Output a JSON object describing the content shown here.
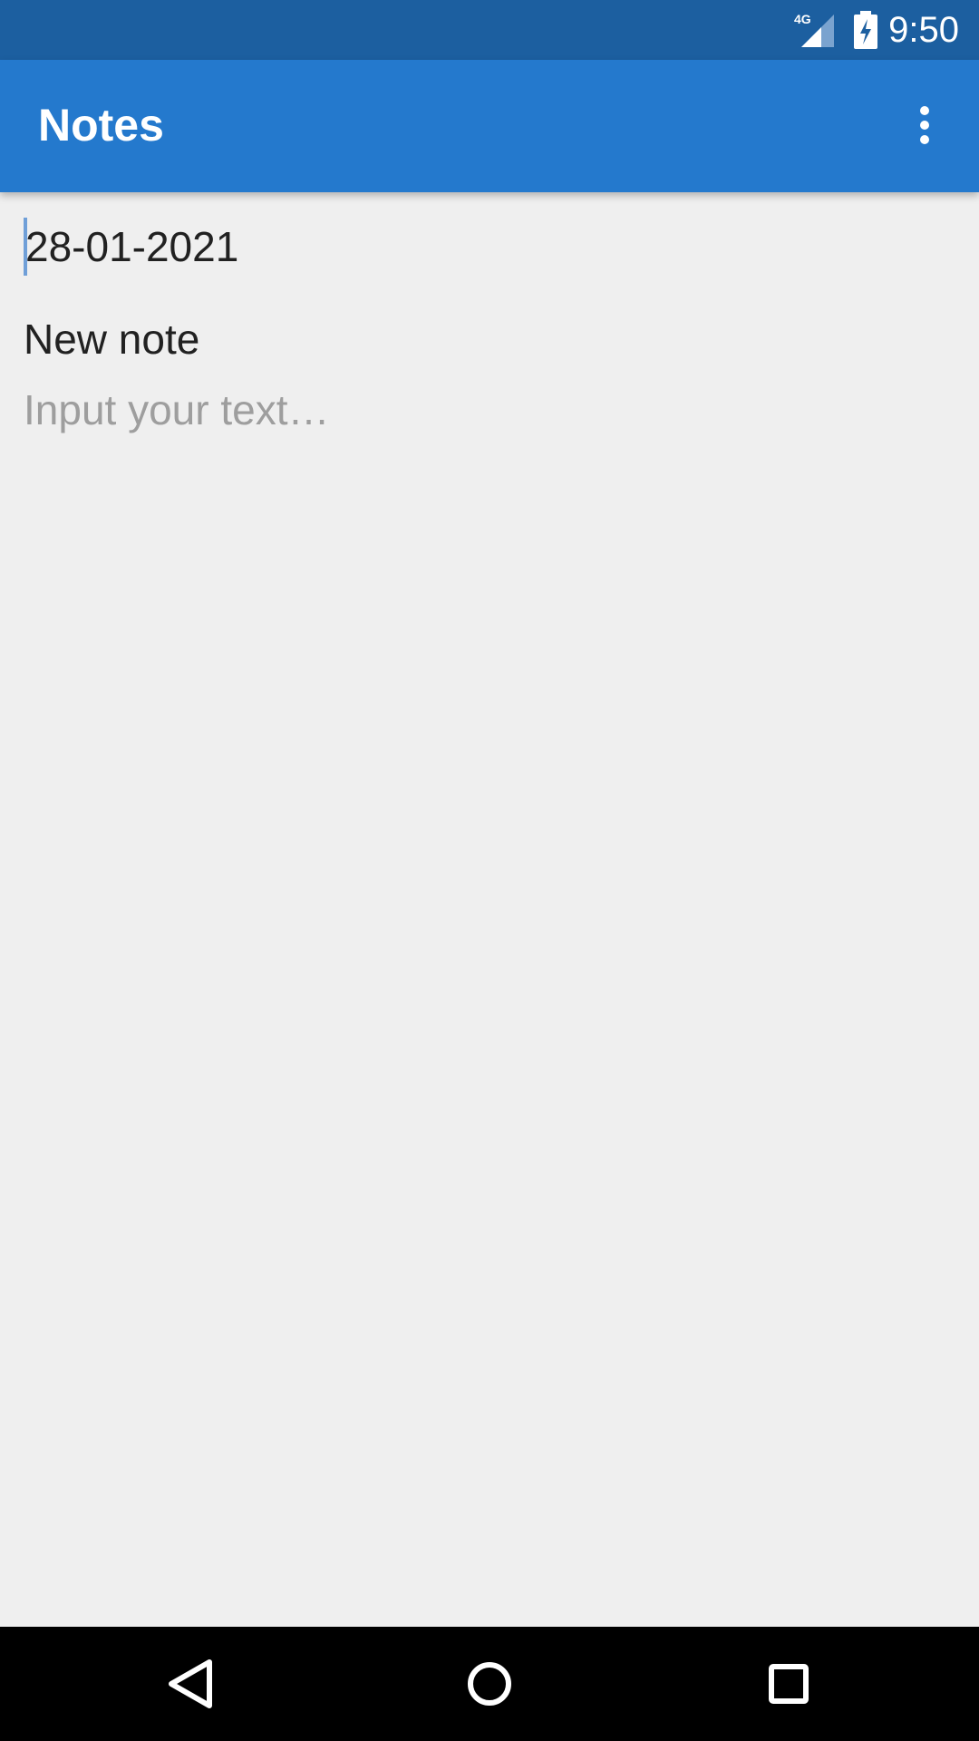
{
  "status_bar": {
    "network_label": "4G",
    "time": "9:50",
    "signal_icon": "signal-icon",
    "battery_icon": "battery-charging-icon"
  },
  "app_bar": {
    "title": "Notes",
    "menu_icon": "more-vert-icon"
  },
  "editor": {
    "date": "28-01-2021",
    "title": "New note",
    "body_placeholder": "Input your text…"
  },
  "nav_bar": {
    "back_icon": "back-icon",
    "home_icon": "home-icon",
    "recents_icon": "recents-icon"
  },
  "colors": {
    "status_bar": "#1c5fa0",
    "app_bar": "#2479cd",
    "background": "#eeeeee",
    "cursor": "#6f9fd8"
  }
}
